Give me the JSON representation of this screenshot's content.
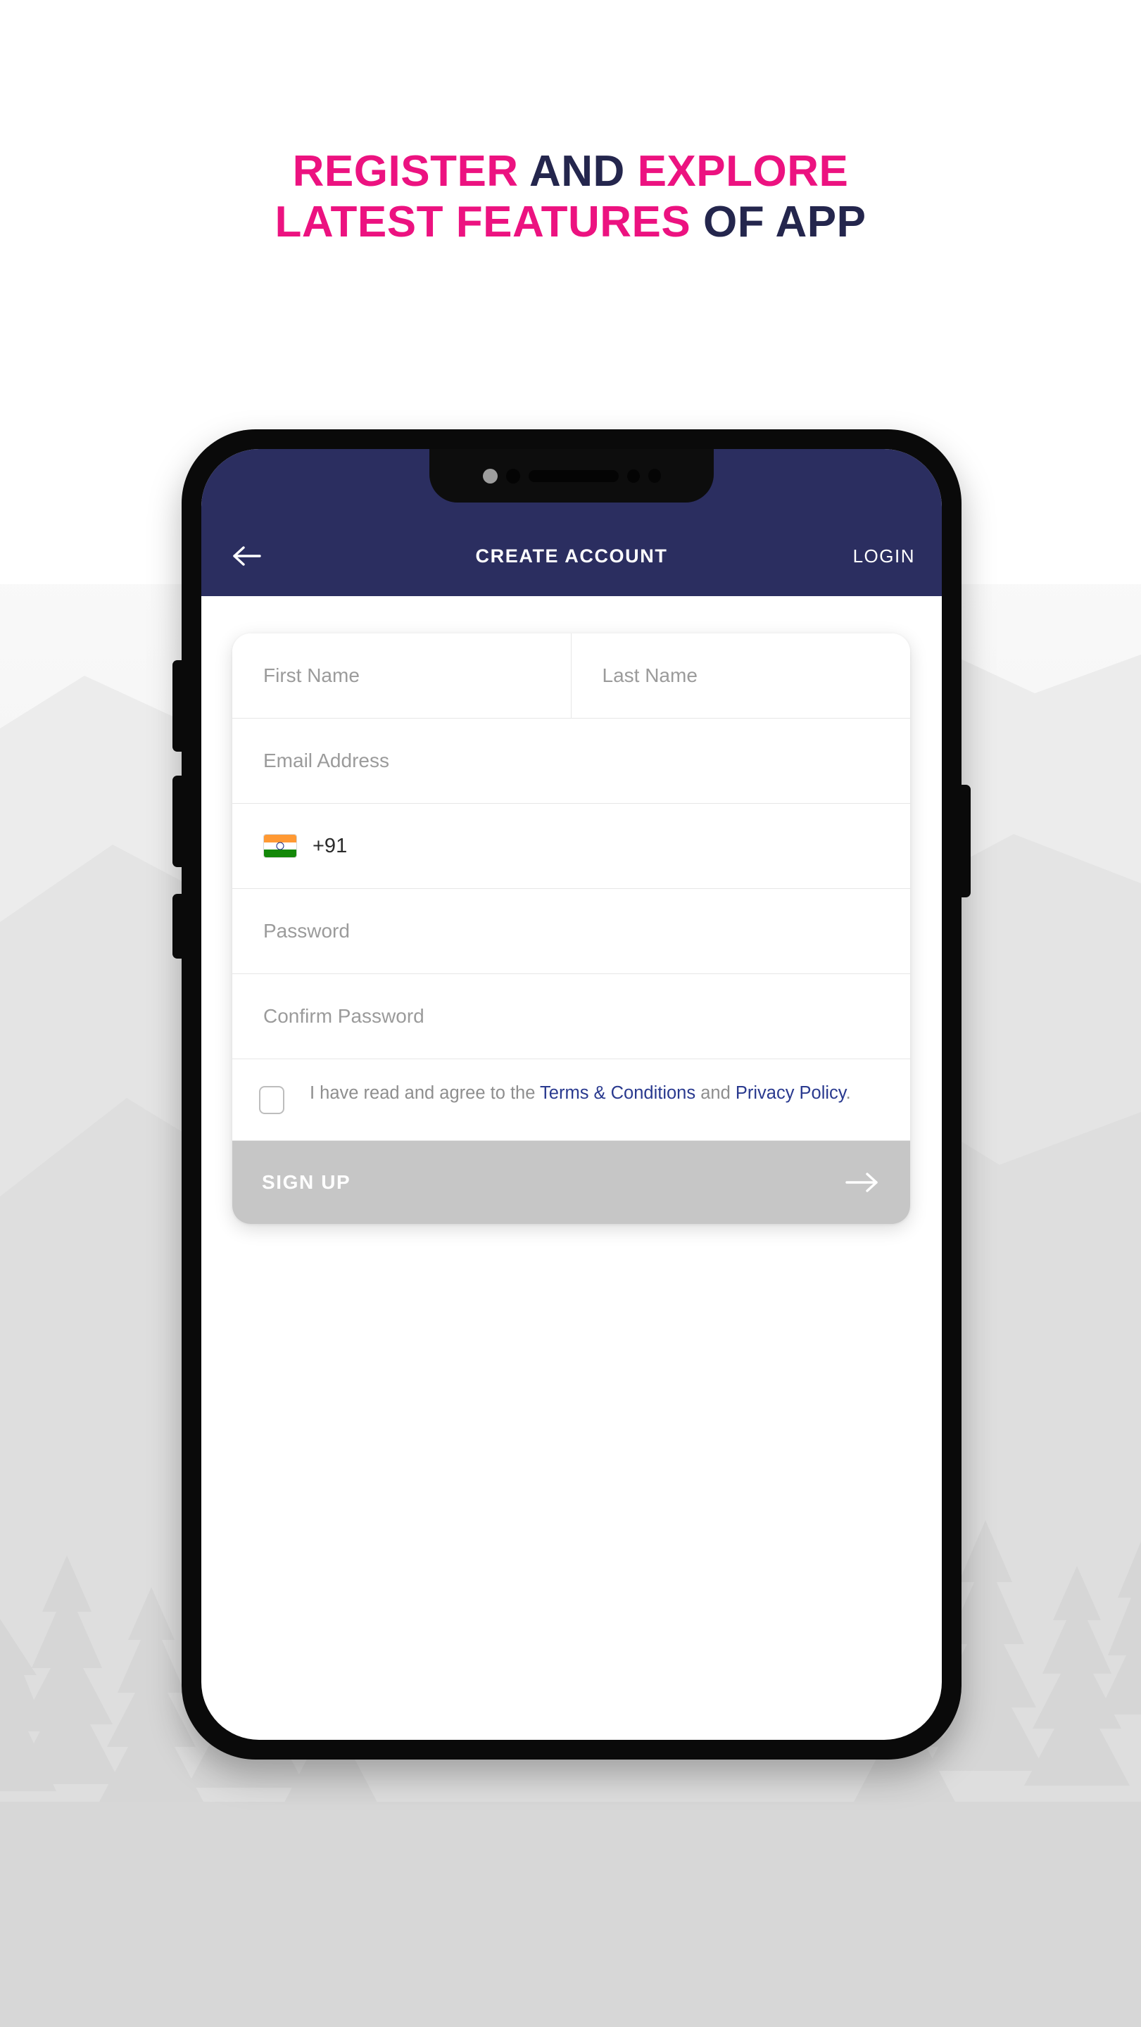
{
  "headline": {
    "line1_part1": "REGISTER ",
    "line1_part2": "AND ",
    "line1_part3": "EXPLORE",
    "line2_part1": "LATEST FEATURES ",
    "line2_part2": "OF APP",
    "color_pink": "#EC1280",
    "color_navy": "#24264D"
  },
  "appbar": {
    "title": "CREATE ACCOUNT",
    "login_label": "LOGIN",
    "back_icon": "arrow-left-icon",
    "background": "#2B2E60"
  },
  "form": {
    "first_name_placeholder": "First Name",
    "last_name_placeholder": "Last Name",
    "email_placeholder": "Email Address",
    "phone": {
      "flag_icon": "india-flag-icon",
      "dial_code": "+91",
      "placeholder": ""
    },
    "password_placeholder": "Password",
    "confirm_password_placeholder": "Confirm Password",
    "terms": {
      "prefix": "I have read and agree to the ",
      "terms_link": "Terms & Conditions",
      "middle": " and ",
      "privacy_link": "Privacy Policy",
      "suffix": ".",
      "checked": false
    },
    "signup": {
      "label": "SIGN UP",
      "arrow_icon": "arrow-right-icon",
      "enabled": false,
      "background": "#C6C6C6"
    }
  },
  "device": {
    "frame_color": "#0A0A0A",
    "screen_background": "#FFFFFF",
    "notch_icons": [
      "camera-icon",
      "sensor-icon",
      "speaker-grille-icon"
    ],
    "side_buttons": [
      "volume-up-button",
      "volume-down-button",
      "mute-button",
      "power-button"
    ]
  },
  "background": {
    "scene": "mountain-forest-silhouette",
    "sky_color": "#F2F2F2",
    "mountain_color": "#E2E2E2",
    "tree_color": "#D5D5D5"
  }
}
